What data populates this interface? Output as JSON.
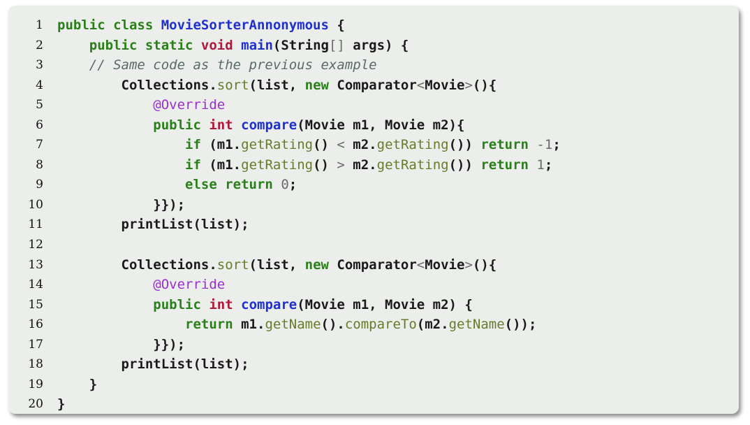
{
  "colors": {
    "background": "#ebeeea",
    "keyword": "#2a7f1a",
    "type": "#b0183a",
    "function": "#1f2fd0",
    "method": "#6a7a2a",
    "annotation": "#9a2fd2",
    "comment": "#5a6a6a",
    "number": "#6a6a6a"
  },
  "lines": [
    {
      "n": "1",
      "tokens": [
        [
          "kw",
          "public class "
        ],
        [
          "fn",
          "MovieSorterAnnonymous"
        ],
        [
          "pl",
          " {"
        ]
      ]
    },
    {
      "n": "2",
      "tokens": [
        [
          "pl",
          "    "
        ],
        [
          "kw",
          "public static "
        ],
        [
          "ty",
          "void "
        ],
        [
          "fn",
          "main"
        ],
        [
          "pl",
          "(String"
        ],
        [
          "op",
          "[]"
        ],
        [
          "pl",
          " args) {"
        ]
      ]
    },
    {
      "n": "3",
      "tokens": [
        [
          "pl",
          "    "
        ],
        [
          "cm",
          "// Same code as the previous example"
        ]
      ]
    },
    {
      "n": "4",
      "tokens": [
        [
          "pl",
          "        Collections."
        ],
        [
          "mt",
          "sort"
        ],
        [
          "pl",
          "(list, "
        ],
        [
          "kw",
          "new "
        ],
        [
          "pl",
          "Comparator"
        ],
        [
          "op",
          "<"
        ],
        [
          "pl",
          "Movie"
        ],
        [
          "op",
          ">"
        ],
        [
          "pl",
          "(){"
        ]
      ]
    },
    {
      "n": "5",
      "tokens": [
        [
          "pl",
          "            "
        ],
        [
          "an",
          "@Override"
        ]
      ]
    },
    {
      "n": "6",
      "tokens": [
        [
          "pl",
          "            "
        ],
        [
          "kw",
          "public "
        ],
        [
          "ty",
          "int "
        ],
        [
          "fn",
          "compare"
        ],
        [
          "pl",
          "(Movie m1, Movie m2){"
        ]
      ]
    },
    {
      "n": "7",
      "tokens": [
        [
          "pl",
          "                "
        ],
        [
          "kw",
          "if "
        ],
        [
          "pl",
          "(m1."
        ],
        [
          "mt",
          "getRating"
        ],
        [
          "pl",
          "() "
        ],
        [
          "op",
          "<"
        ],
        [
          "pl",
          " m2."
        ],
        [
          "mt",
          "getRating"
        ],
        [
          "pl",
          "()) "
        ],
        [
          "kw",
          "return "
        ],
        [
          "nm",
          "-1"
        ],
        [
          "pl",
          ";"
        ]
      ]
    },
    {
      "n": "8",
      "tokens": [
        [
          "pl",
          "                "
        ],
        [
          "kw",
          "if "
        ],
        [
          "pl",
          "(m1."
        ],
        [
          "mt",
          "getRating"
        ],
        [
          "pl",
          "() "
        ],
        [
          "op",
          ">"
        ],
        [
          "pl",
          " m2."
        ],
        [
          "mt",
          "getRating"
        ],
        [
          "pl",
          "()) "
        ],
        [
          "kw",
          "return "
        ],
        [
          "nm",
          "1"
        ],
        [
          "pl",
          ";"
        ]
      ]
    },
    {
      "n": "9",
      "tokens": [
        [
          "pl",
          "                "
        ],
        [
          "kw",
          "else return "
        ],
        [
          "nm",
          "0"
        ],
        [
          "pl",
          ";"
        ]
      ]
    },
    {
      "n": "10",
      "tokens": [
        [
          "pl",
          "            }});"
        ]
      ]
    },
    {
      "n": "11",
      "tokens": [
        [
          "pl",
          "        printList(list);"
        ]
      ]
    },
    {
      "n": "12",
      "tokens": []
    },
    {
      "n": "13",
      "tokens": [
        [
          "pl",
          "        Collections."
        ],
        [
          "mt",
          "sort"
        ],
        [
          "pl",
          "(list, "
        ],
        [
          "kw",
          "new "
        ],
        [
          "pl",
          "Comparator"
        ],
        [
          "op",
          "<"
        ],
        [
          "pl",
          "Movie"
        ],
        [
          "op",
          ">"
        ],
        [
          "pl",
          "(){"
        ]
      ]
    },
    {
      "n": "14",
      "tokens": [
        [
          "pl",
          "            "
        ],
        [
          "an",
          "@Override"
        ]
      ]
    },
    {
      "n": "15",
      "tokens": [
        [
          "pl",
          "            "
        ],
        [
          "kw",
          "public "
        ],
        [
          "ty",
          "int "
        ],
        [
          "fn",
          "compare"
        ],
        [
          "pl",
          "(Movie m1, Movie m2) {"
        ]
      ]
    },
    {
      "n": "16",
      "tokens": [
        [
          "pl",
          "                "
        ],
        [
          "kw",
          "return "
        ],
        [
          "pl",
          "m1."
        ],
        [
          "mt",
          "getName"
        ],
        [
          "pl",
          "()."
        ],
        [
          "mt",
          "compareTo"
        ],
        [
          "pl",
          "(m2."
        ],
        [
          "mt",
          "getName"
        ],
        [
          "pl",
          "());"
        ]
      ]
    },
    {
      "n": "17",
      "tokens": [
        [
          "pl",
          "            }});"
        ]
      ]
    },
    {
      "n": "18",
      "tokens": [
        [
          "pl",
          "        printList(list);"
        ]
      ]
    },
    {
      "n": "19",
      "tokens": [
        [
          "pl",
          "    }"
        ]
      ]
    },
    {
      "n": "20",
      "tokens": [
        [
          "pl",
          "}"
        ]
      ]
    }
  ]
}
